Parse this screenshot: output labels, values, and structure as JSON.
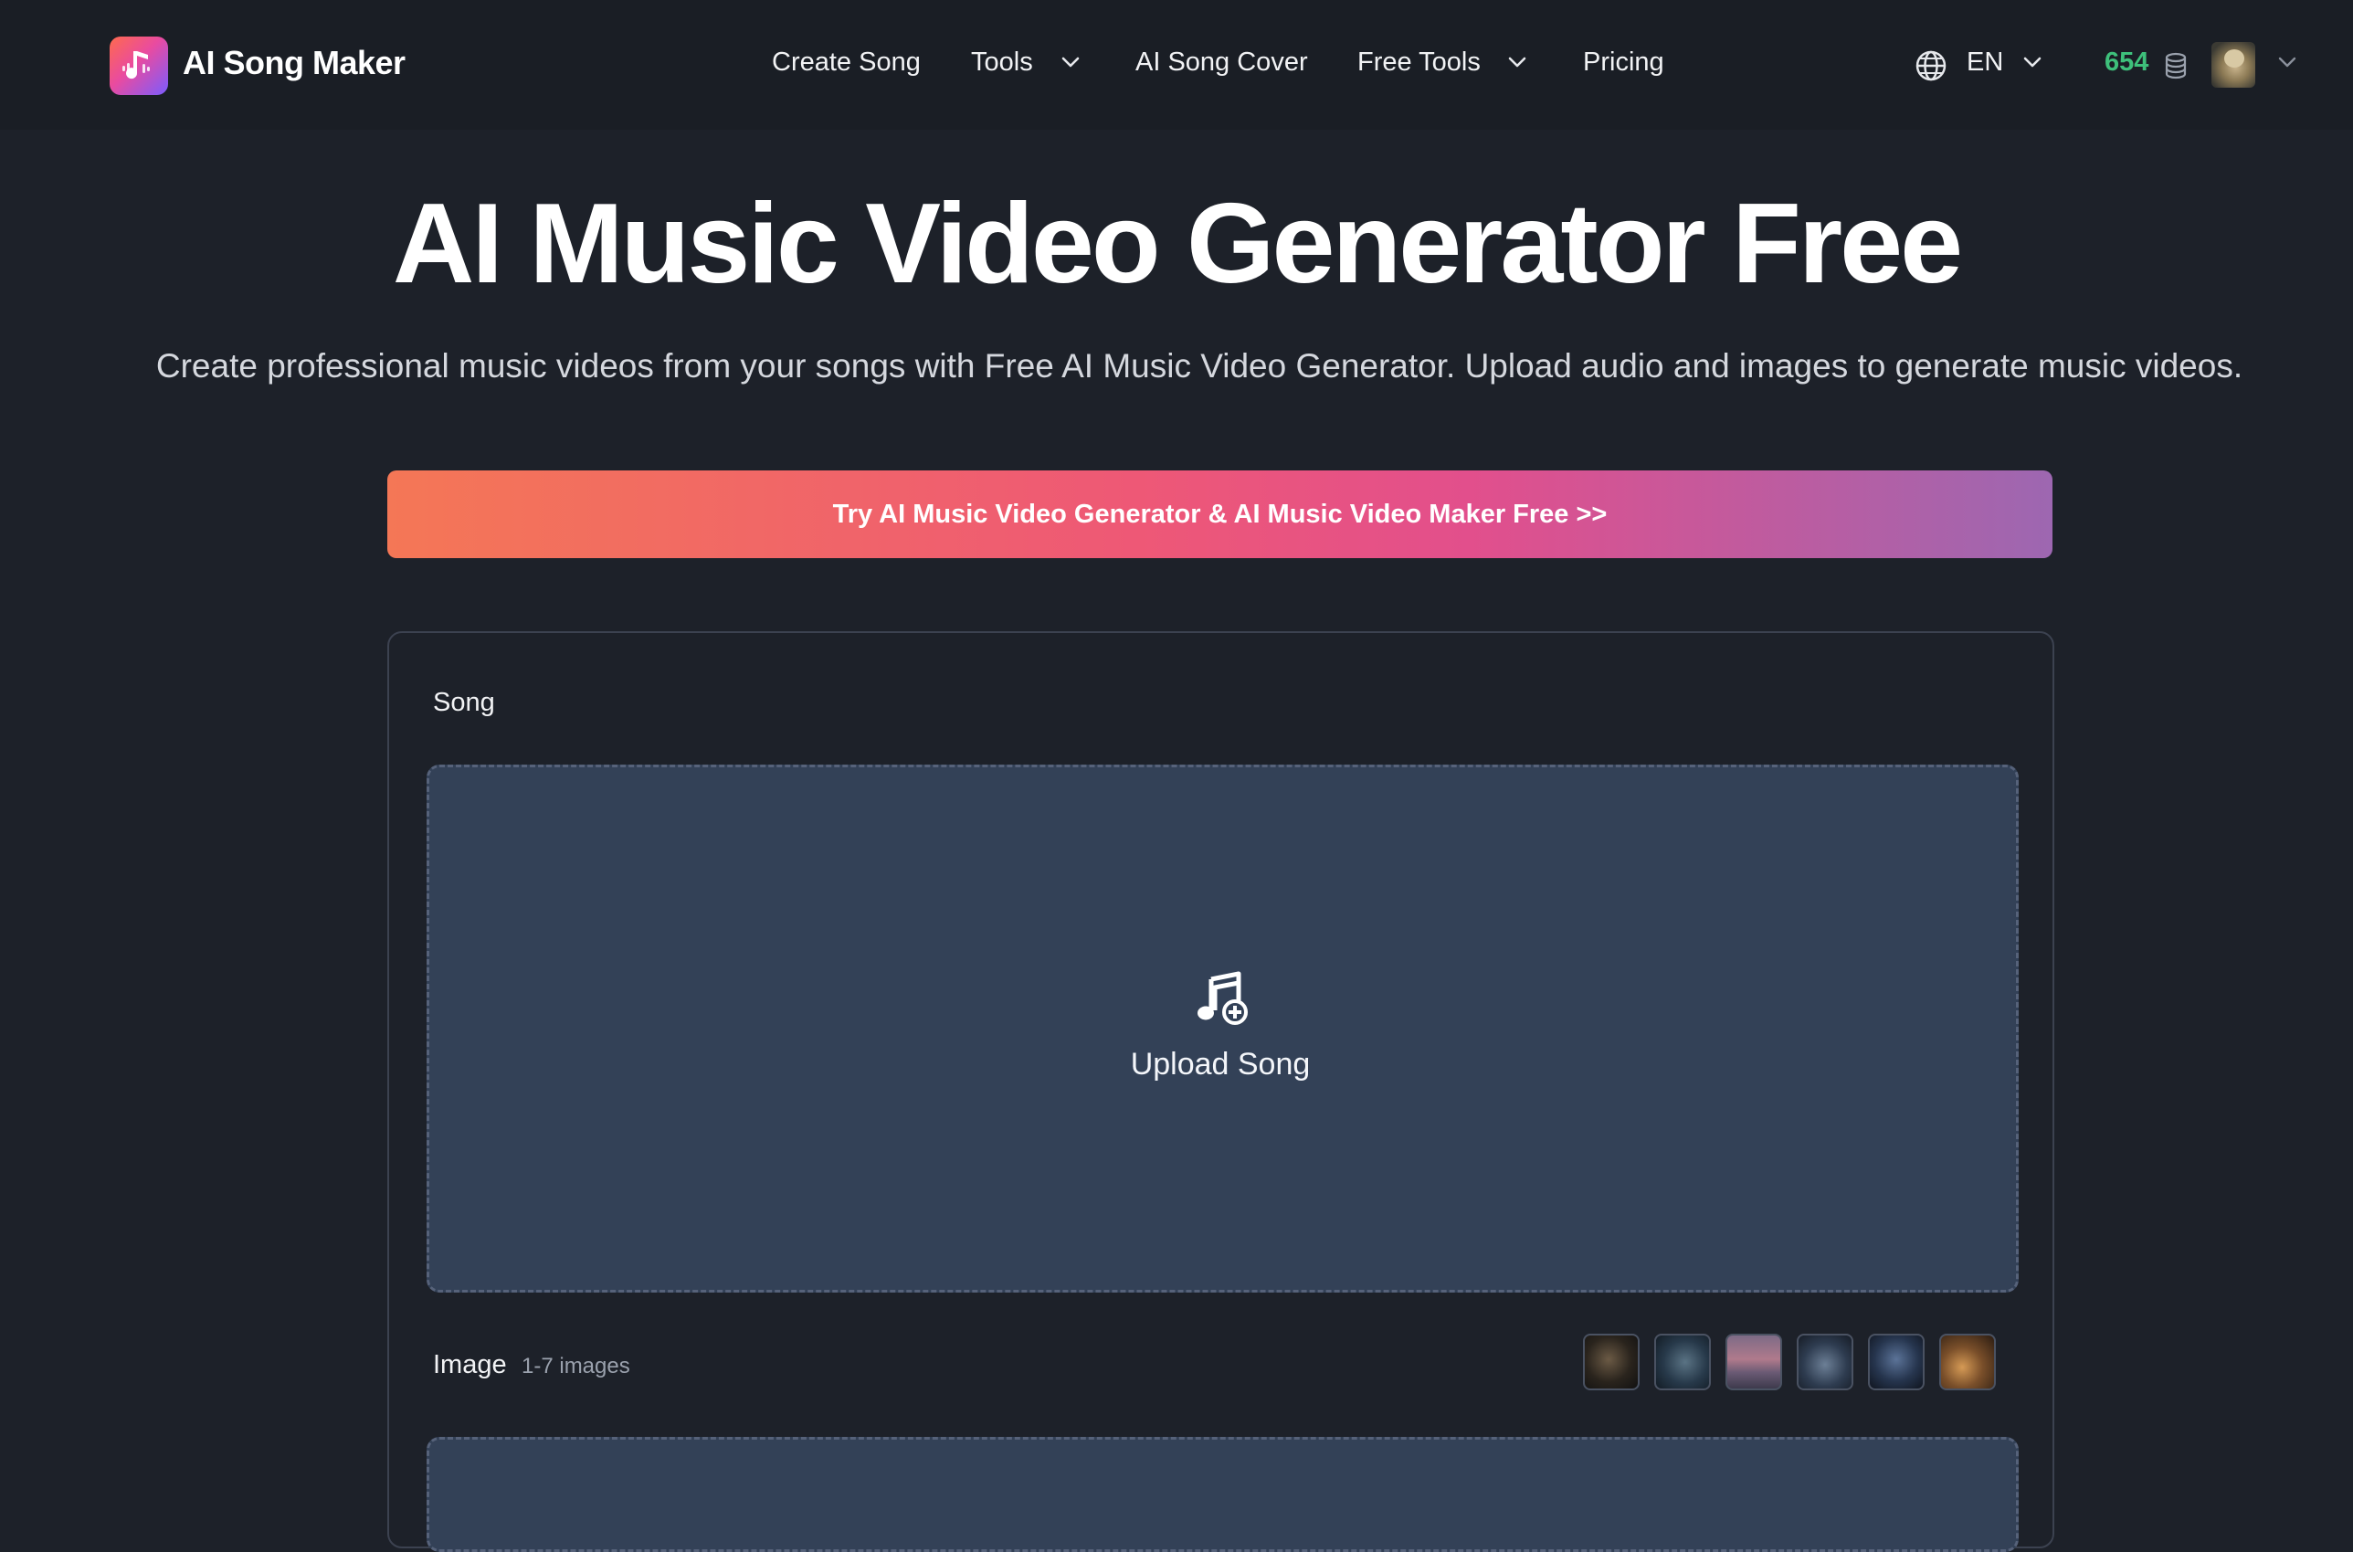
{
  "header": {
    "brand": "AI Song Maker",
    "nav": [
      {
        "label": "Create Song"
      },
      {
        "label": "Tools"
      },
      {
        "label": "AI Song Cover"
      },
      {
        "label": "Free Tools"
      },
      {
        "label": "Pricing"
      }
    ],
    "language": "EN",
    "credits": "654"
  },
  "hero": {
    "title": "AI Music Video Generator Free",
    "subtitle": "Create professional music videos from your songs with Free AI Music Video Generator. Upload audio and images to generate music videos.",
    "cta": "Try AI Music Video Generator & AI Music Video Maker Free >>"
  },
  "form": {
    "song_label": "Song",
    "upload_label": "Upload Song",
    "image_label": "Image",
    "image_hint": "1-7 images"
  },
  "colors": {
    "background": "#1d2129",
    "credits": "#3ec07b",
    "dropzone": "#334157"
  }
}
